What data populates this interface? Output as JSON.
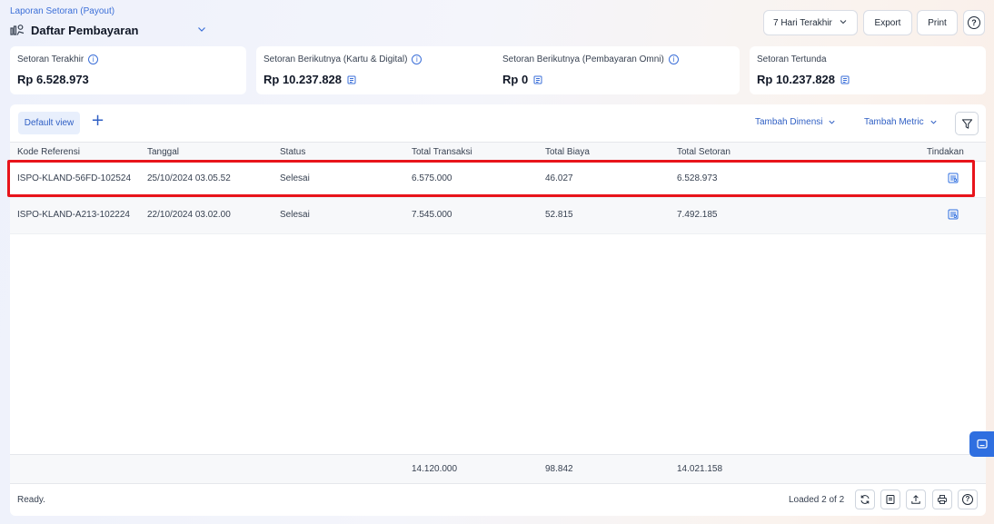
{
  "header": {
    "breadcrumb": "Laporan Setoran (Payout)",
    "title": "Daftar Pembayaran",
    "date_range": "7 Hari Terakhir",
    "export_label": "Export",
    "print_label": "Print",
    "help_label": "?"
  },
  "cards": [
    {
      "label": "Setoran Terakhir",
      "value": "Rp 6.528.973"
    },
    {
      "label": "Setoran Berikutnya (Kartu & Digital)",
      "value": "Rp 10.237.828"
    },
    {
      "label": "Setoran Berikutnya (Pembayaran Omni)",
      "value": "Rp 0"
    },
    {
      "label": "Setoran Tertunda",
      "value": "Rp 10.237.828"
    }
  ],
  "toolbar": {
    "view_label": "Default view",
    "add_view": "+",
    "add_dimension": "Tambah Dimensi",
    "add_metric": "Tambah Metric"
  },
  "table": {
    "columns": [
      "Kode Referensi",
      "Tanggal",
      "Status",
      "Total Transaksi",
      "Total Biaya",
      "Total Setoran",
      "Tindakan"
    ],
    "rows": [
      [
        "ISPO-KLAND-56FD-102524",
        "25/10/2024 03.05.52",
        "Selesai",
        "6.575.000",
        "46.027",
        "6.528.973"
      ],
      [
        "ISPO-KLAND-A213-102224",
        "22/10/2024 03.02.00",
        "Selesai",
        "7.545.000",
        "52.815",
        "7.492.185"
      ]
    ],
    "totals": [
      "14.120.000",
      "98.842",
      "14.021.158"
    ]
  },
  "footer": {
    "status": "Ready.",
    "loaded": "Loaded 2 of 2"
  },
  "colors": {
    "accent": "#2f5fc4",
    "highlight": "#e8141b",
    "side_tab": "#2f6fe0"
  }
}
